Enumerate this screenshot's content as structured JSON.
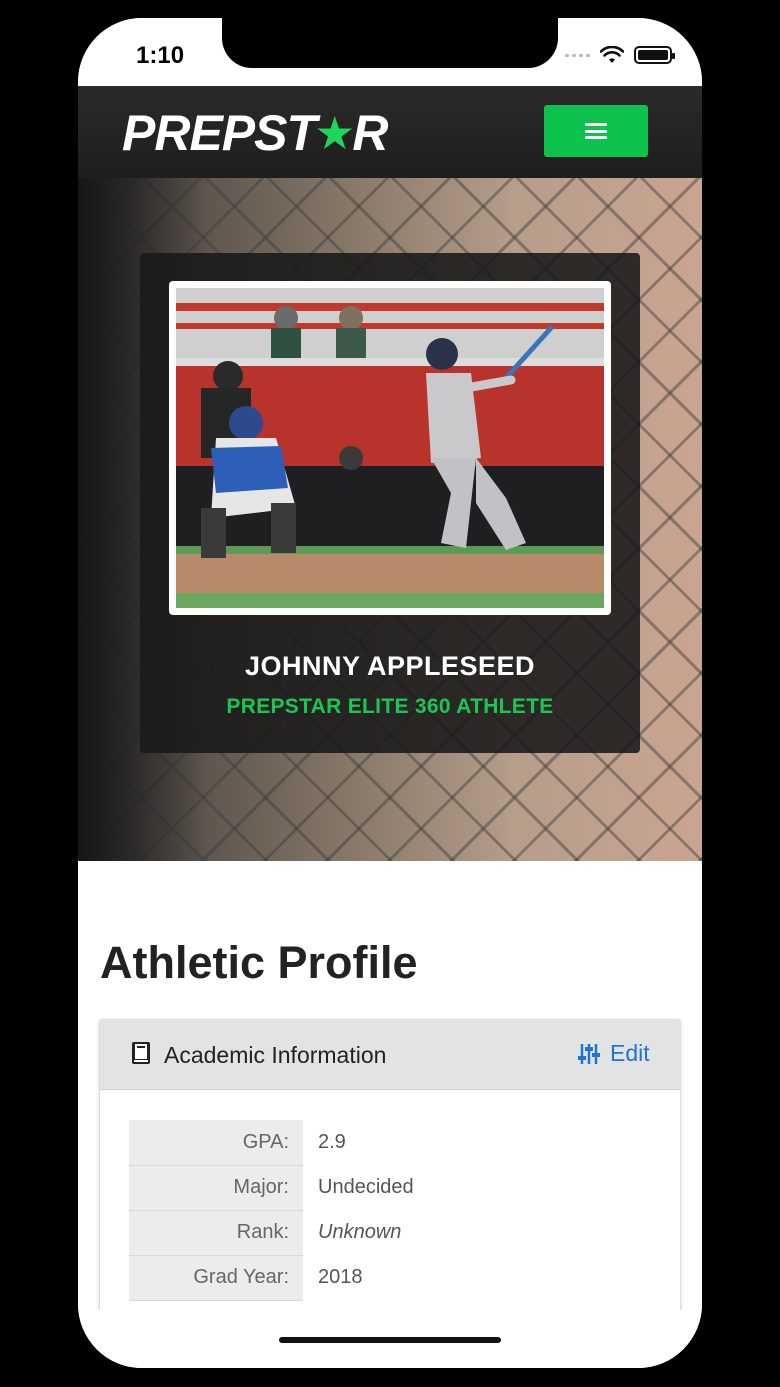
{
  "status_bar": {
    "time": "1:10"
  },
  "navbar": {
    "logo_prefix": "PREPST",
    "logo_star": "★",
    "logo_suffix": "R",
    "menu_icon": "hamburger-icon",
    "brand_color": "#0dc24d"
  },
  "hero": {
    "athlete_name": "JOHNNY APPLESEED",
    "subtitle": "PREPSTAR ELITE 360 ATHLETE",
    "subtitle_color": "#18c754"
  },
  "profile": {
    "title": "Athletic Profile",
    "card": {
      "title": "Academic Information",
      "icon": "book-icon",
      "edit_label": "Edit",
      "edit_icon": "sliders-icon",
      "edit_color": "#1d76d2"
    },
    "rows": [
      {
        "label": "GPA:",
        "value": "2.9"
      },
      {
        "label": "Major:",
        "value": "Undecided"
      },
      {
        "label": "Rank:",
        "value": "Unknown"
      },
      {
        "label": "Grad Year:",
        "value": "2018"
      }
    ]
  }
}
